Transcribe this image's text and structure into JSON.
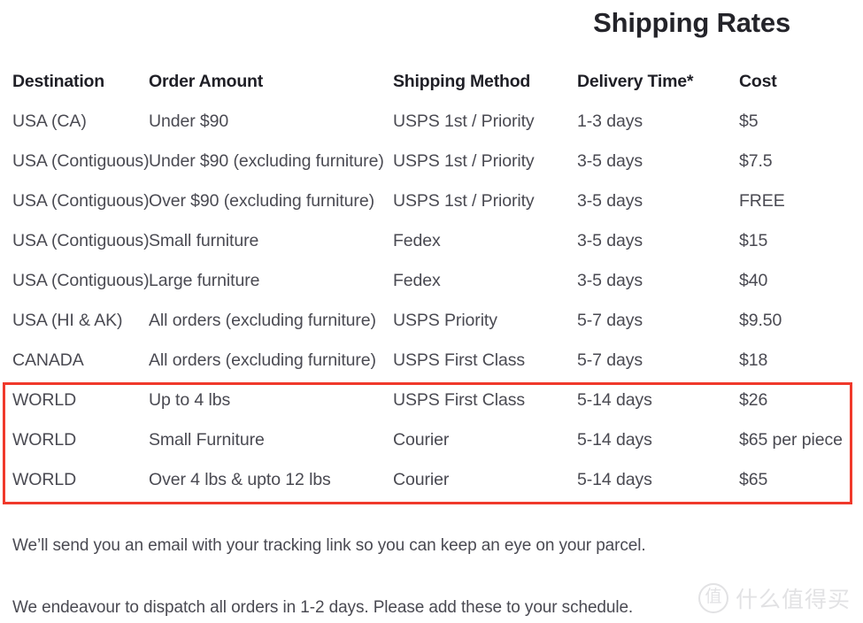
{
  "page": {
    "title": "Shipping Rates"
  },
  "table": {
    "headers": {
      "destination": "Destination",
      "order_amount": "Order Amount",
      "shipping_method": "Shipping Method",
      "delivery_time": "Delivery Time*",
      "cost": "Cost"
    },
    "rows": [
      {
        "destination": "USA (CA)",
        "order_amount": "Under $90",
        "shipping_method": "USPS 1st / Priority",
        "delivery_time": "1-3 days",
        "cost": "$5"
      },
      {
        "destination": "USA (Contiguous)",
        "order_amount": "Under $90 (excluding furniture)",
        "shipping_method": "USPS 1st / Priority",
        "delivery_time": "3-5 days",
        "cost": "$7.5"
      },
      {
        "destination": "USA (Contiguous)",
        "order_amount": "Over $90 (excluding furniture)",
        "shipping_method": "USPS 1st / Priority",
        "delivery_time": "3-5 days",
        "cost": "FREE"
      },
      {
        "destination": "USA (Contiguous)",
        "order_amount": "Small furniture",
        "shipping_method": "Fedex",
        "delivery_time": "3-5 days",
        "cost": "$15"
      },
      {
        "destination": "USA (Contiguous)",
        "order_amount": "Large furniture",
        "shipping_method": "Fedex",
        "delivery_time": "3-5 days",
        "cost": "$40"
      },
      {
        "destination": "USA (HI & AK)",
        "order_amount": "All orders (excluding furniture)",
        "shipping_method": "USPS Priority",
        "delivery_time": "5-7 days",
        "cost": "$9.50"
      },
      {
        "destination": "CANADA",
        "order_amount": "All orders (excluding furniture)",
        "shipping_method": "USPS First Class",
        "delivery_time": "5-7 days",
        "cost": "$18"
      },
      {
        "destination": "WORLD",
        "order_amount": "Up to 4 lbs",
        "shipping_method": "USPS First Class",
        "delivery_time": "5-14 days",
        "cost": "$26"
      },
      {
        "destination": "WORLD",
        "order_amount": "Small Furniture",
        "shipping_method": "Courier",
        "delivery_time": "5-14 days",
        "cost": "$65 per piece"
      },
      {
        "destination": "WORLD",
        "order_amount": "Over 4 lbs & upto 12 lbs",
        "shipping_method": "Courier",
        "delivery_time": "5-14 days",
        "cost": "$65"
      }
    ]
  },
  "highlight": {
    "color": "#f0392b",
    "covers_rows": [
      7,
      8,
      9
    ]
  },
  "notes": {
    "line_1": "We’ll send you an email with your tracking link so you can keep an eye on your parcel.",
    "line_2": "We endeavour to dispatch all orders in 1-2 days. Please add these to your schedule."
  },
  "watermark": {
    "logo_glyph": "值",
    "text": "什么值得买",
    "color": "#e2e2e4"
  }
}
